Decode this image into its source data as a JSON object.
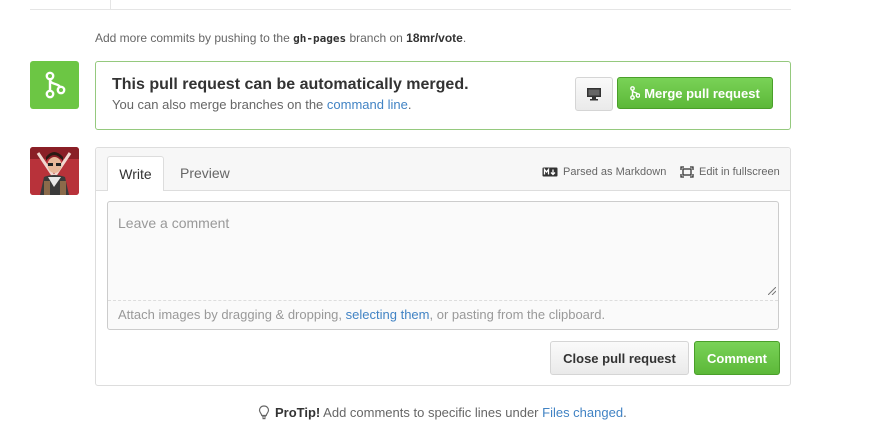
{
  "hint": {
    "prefix": "Add more commits by pushing to the",
    "branch": "gh-pages",
    "middle": "branch on",
    "repo": "18mr/vote",
    "suffix": "."
  },
  "merge": {
    "title": "This pull request can be automatically merged.",
    "sub_prefix": "You can also merge branches on the",
    "sub_link": "command line",
    "sub_suffix": ".",
    "button_label": "Merge pull request",
    "desktop_icon": "desktop-icon",
    "merge_icon": "git-merge-icon"
  },
  "comment": {
    "tabs": [
      {
        "label": "Write"
      },
      {
        "label": "Preview"
      }
    ],
    "markdown_hint": "Parsed as Markdown",
    "fullscreen_hint": "Edit in fullscreen",
    "placeholder": "Leave a comment",
    "attach_prefix": "Attach images by dragging & dropping,",
    "attach_link": "selecting them",
    "attach_suffix": ", or pasting from the clipboard.",
    "close_button": "Close pull request",
    "comment_button": "Comment"
  },
  "protip": {
    "label": "ProTip!",
    "text": "Add comments to specific lines under",
    "link": "Files changed",
    "suffix": "."
  },
  "colors": {
    "accent_green": "#6cc644",
    "link_blue": "#4183c4"
  }
}
